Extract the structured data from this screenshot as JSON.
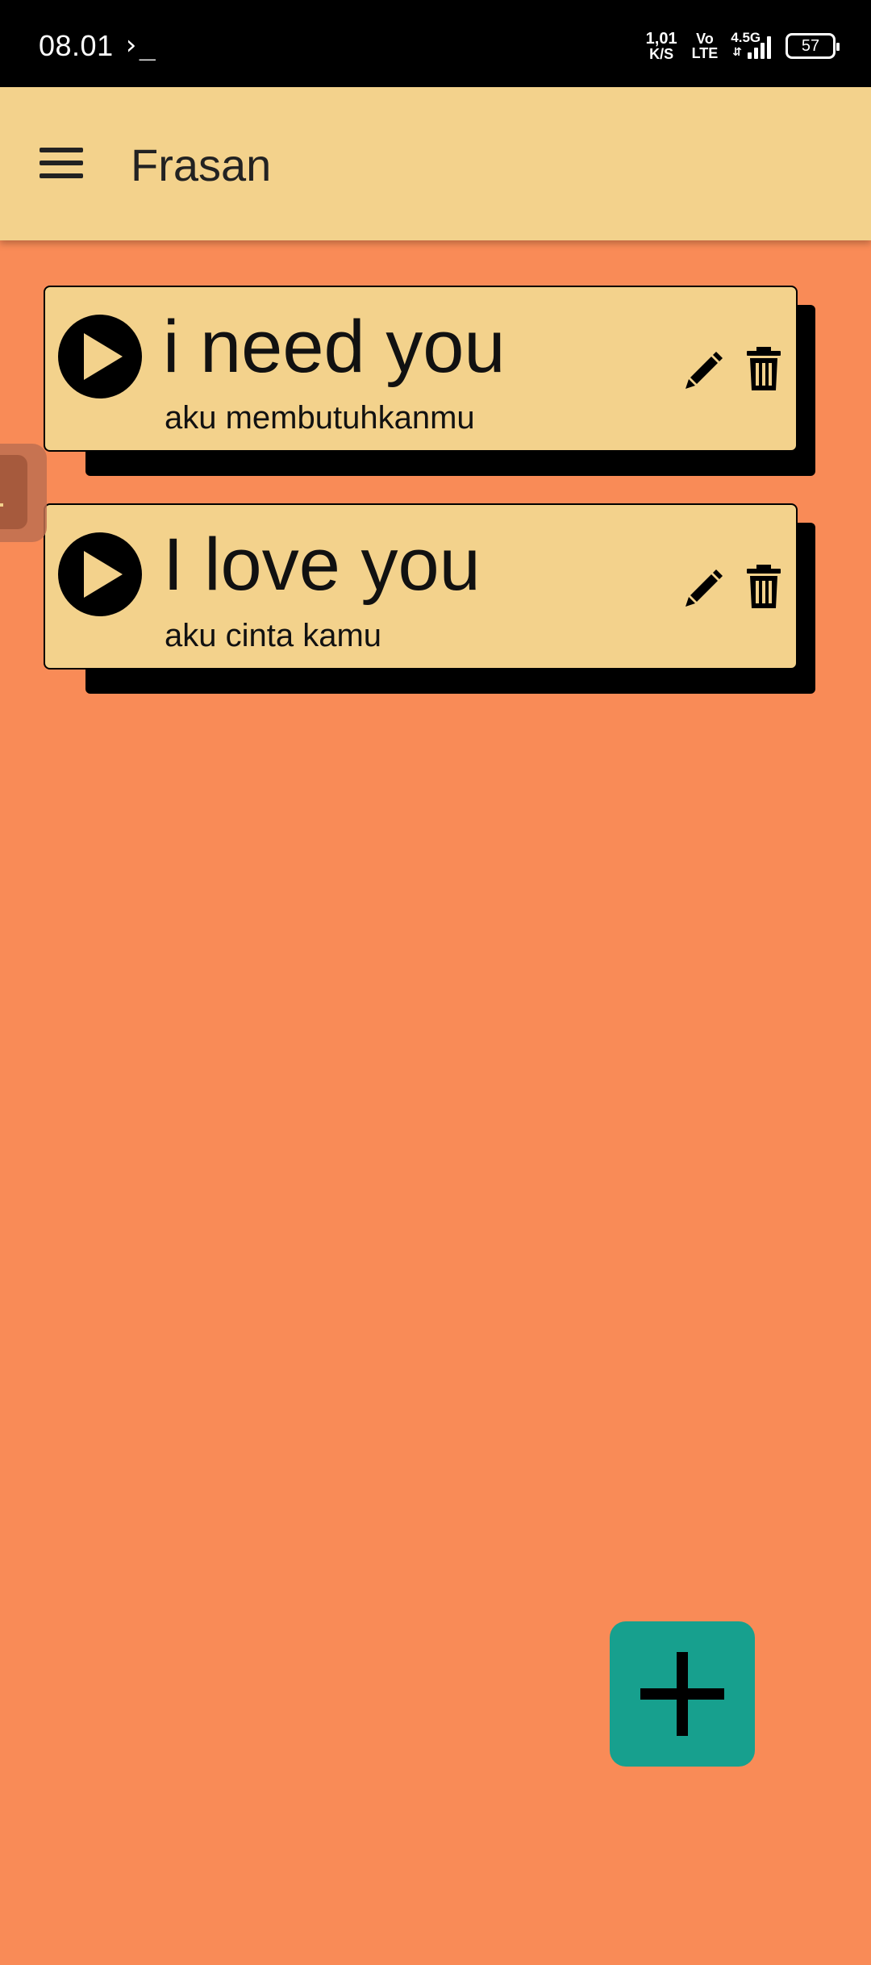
{
  "status_bar": {
    "time": "08.01",
    "terminal_glyph": "›_",
    "net_speed_value": "1,01",
    "net_speed_unit": "K/S",
    "volte_top": "Vo",
    "volte_bottom": "LTE",
    "network_type": "4.5G",
    "battery_level": "57"
  },
  "app_bar": {
    "title": "Frasan",
    "menu_icon": "hamburger-menu-icon"
  },
  "phrases": [
    {
      "phrase": "i need you",
      "translation": "aku membutuhkanmu"
    },
    {
      "phrase": "I love you",
      "translation": "aku cinta kamu"
    }
  ],
  "colors": {
    "background": "#F98B57",
    "app_bar": "#F3D28C",
    "card": "#F3D28C",
    "fab": "#17A08E"
  },
  "fab": {
    "icon": "plus-icon"
  }
}
